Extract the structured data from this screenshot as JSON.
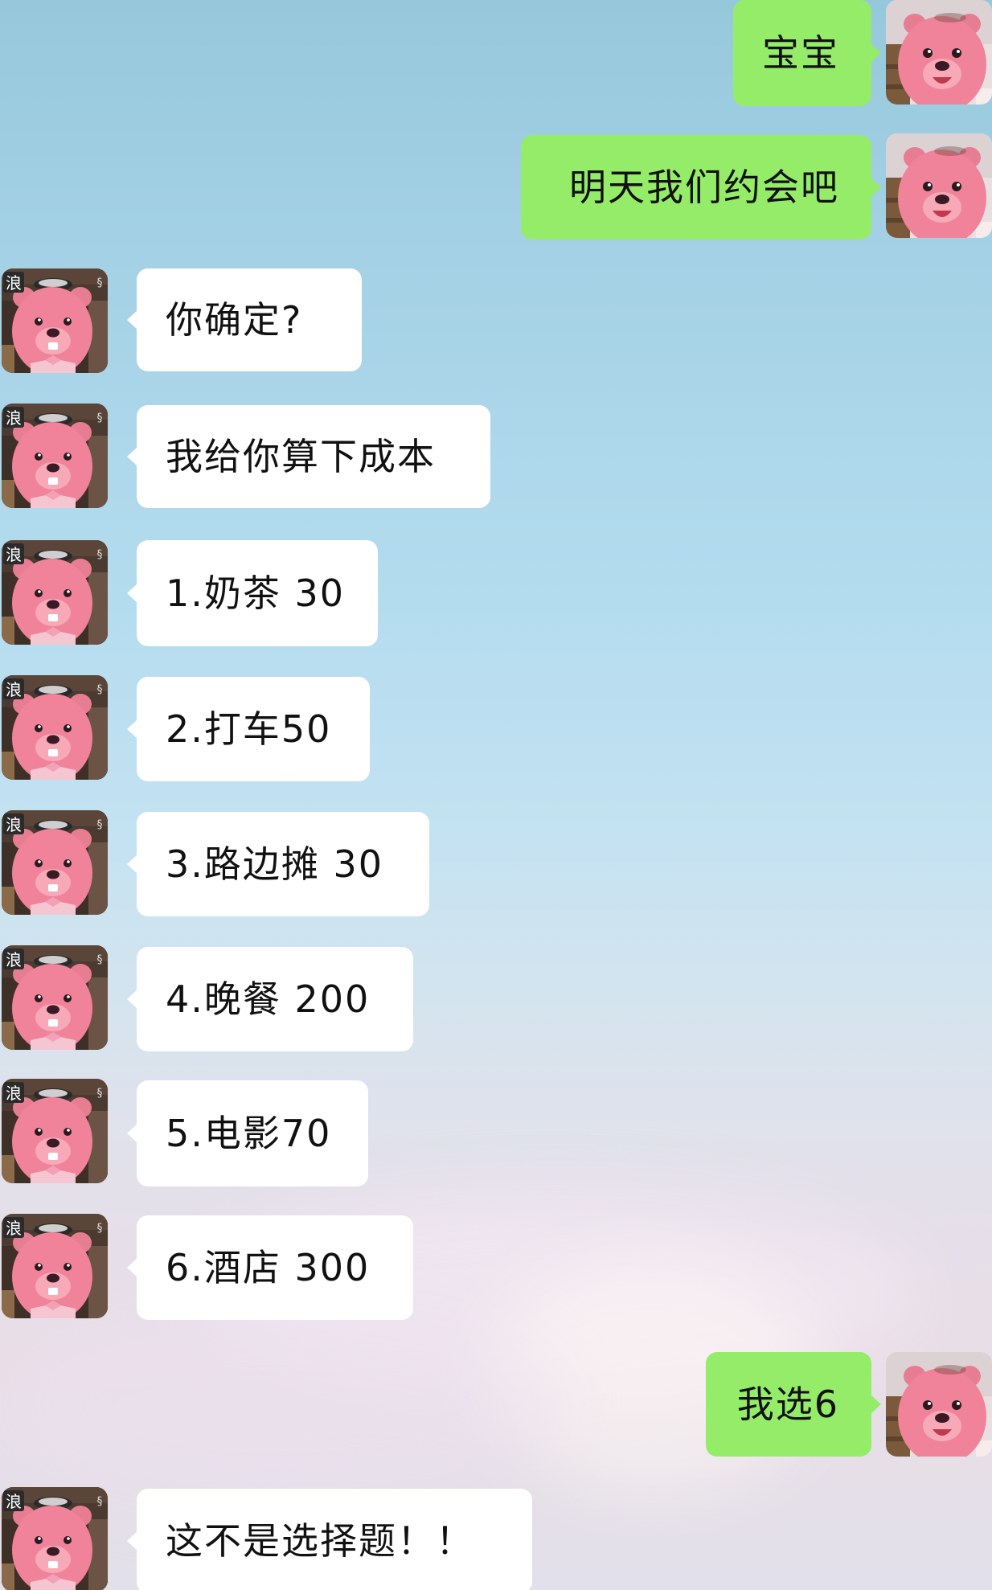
{
  "chat": {
    "messages": [
      {
        "sender": "me",
        "text": "宝宝"
      },
      {
        "sender": "me",
        "text": "明天我们约会吧"
      },
      {
        "sender": "contact",
        "text": "你确定?"
      },
      {
        "sender": "contact",
        "text": "我给你算下成本"
      },
      {
        "sender": "contact",
        "text": "1.奶茶 30"
      },
      {
        "sender": "contact",
        "text": "2.打车50"
      },
      {
        "sender": "contact",
        "text": "3.路边摊 30"
      },
      {
        "sender": "contact",
        "text": "4.晚餐 200"
      },
      {
        "sender": "contact",
        "text": "5.电影70"
      },
      {
        "sender": "contact",
        "text": "6.酒店 300"
      },
      {
        "sender": "me",
        "text": "我选6"
      },
      {
        "sender": "contact",
        "text": "这不是选择题！！"
      }
    ]
  },
  "avatars": {
    "me": {
      "icon": "pink-beaver-avatar-icon"
    },
    "contact": {
      "icon": "pink-beaver-avatar-icon",
      "badge_text": "浪"
    }
  },
  "colors": {
    "outgoing_bubble": "#95ec69",
    "incoming_bubble": "#ffffff",
    "avatar_pink": "#f0839a"
  }
}
